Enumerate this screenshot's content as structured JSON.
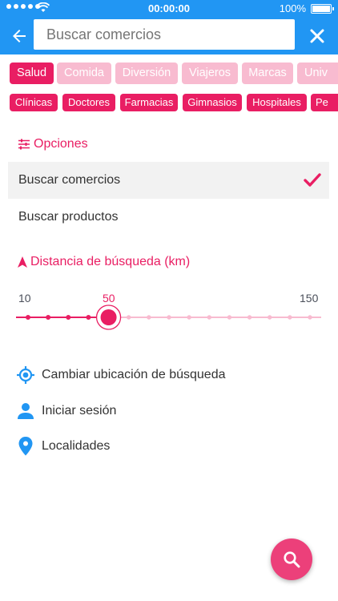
{
  "status_bar": {
    "time": "00:00:00",
    "battery": "100%"
  },
  "search": {
    "placeholder": "Buscar comercios"
  },
  "categories_row1": [
    {
      "label": "Salud",
      "active": true
    },
    {
      "label": "Comida",
      "active": false
    },
    {
      "label": "Diversión",
      "active": false
    },
    {
      "label": "Viajeros",
      "active": false
    },
    {
      "label": "Marcas",
      "active": false
    },
    {
      "label": "Univ",
      "active": false
    }
  ],
  "categories_row2": [
    {
      "label": "Clínicas"
    },
    {
      "label": "Doctores"
    },
    {
      "label": "Farmacias"
    },
    {
      "label": "Gimnasios"
    },
    {
      "label": "Hospitales"
    },
    {
      "label": "Pe"
    }
  ],
  "options": {
    "title": "Opciones",
    "items": [
      {
        "label": "Buscar comercios",
        "selected": true
      },
      {
        "label": "Buscar productos",
        "selected": false
      }
    ]
  },
  "distance": {
    "title": "Distancia de búsqueda (km)",
    "min": "10",
    "current": "50",
    "max": "150",
    "value_km": 50,
    "range_km": [
      10,
      150
    ],
    "step_km": 10
  },
  "actions": [
    {
      "label": "Cambiar ubicación de búsqueda",
      "icon": "gps-target-icon"
    },
    {
      "label": "Iniciar sesión",
      "icon": "person-icon"
    },
    {
      "label": "Localidades",
      "icon": "location-pin-icon"
    }
  ],
  "colors": {
    "primary": "#2196f3",
    "accent": "#e91e63",
    "chip_inactive": "#f8bbd0",
    "fab": "#ec407a"
  }
}
